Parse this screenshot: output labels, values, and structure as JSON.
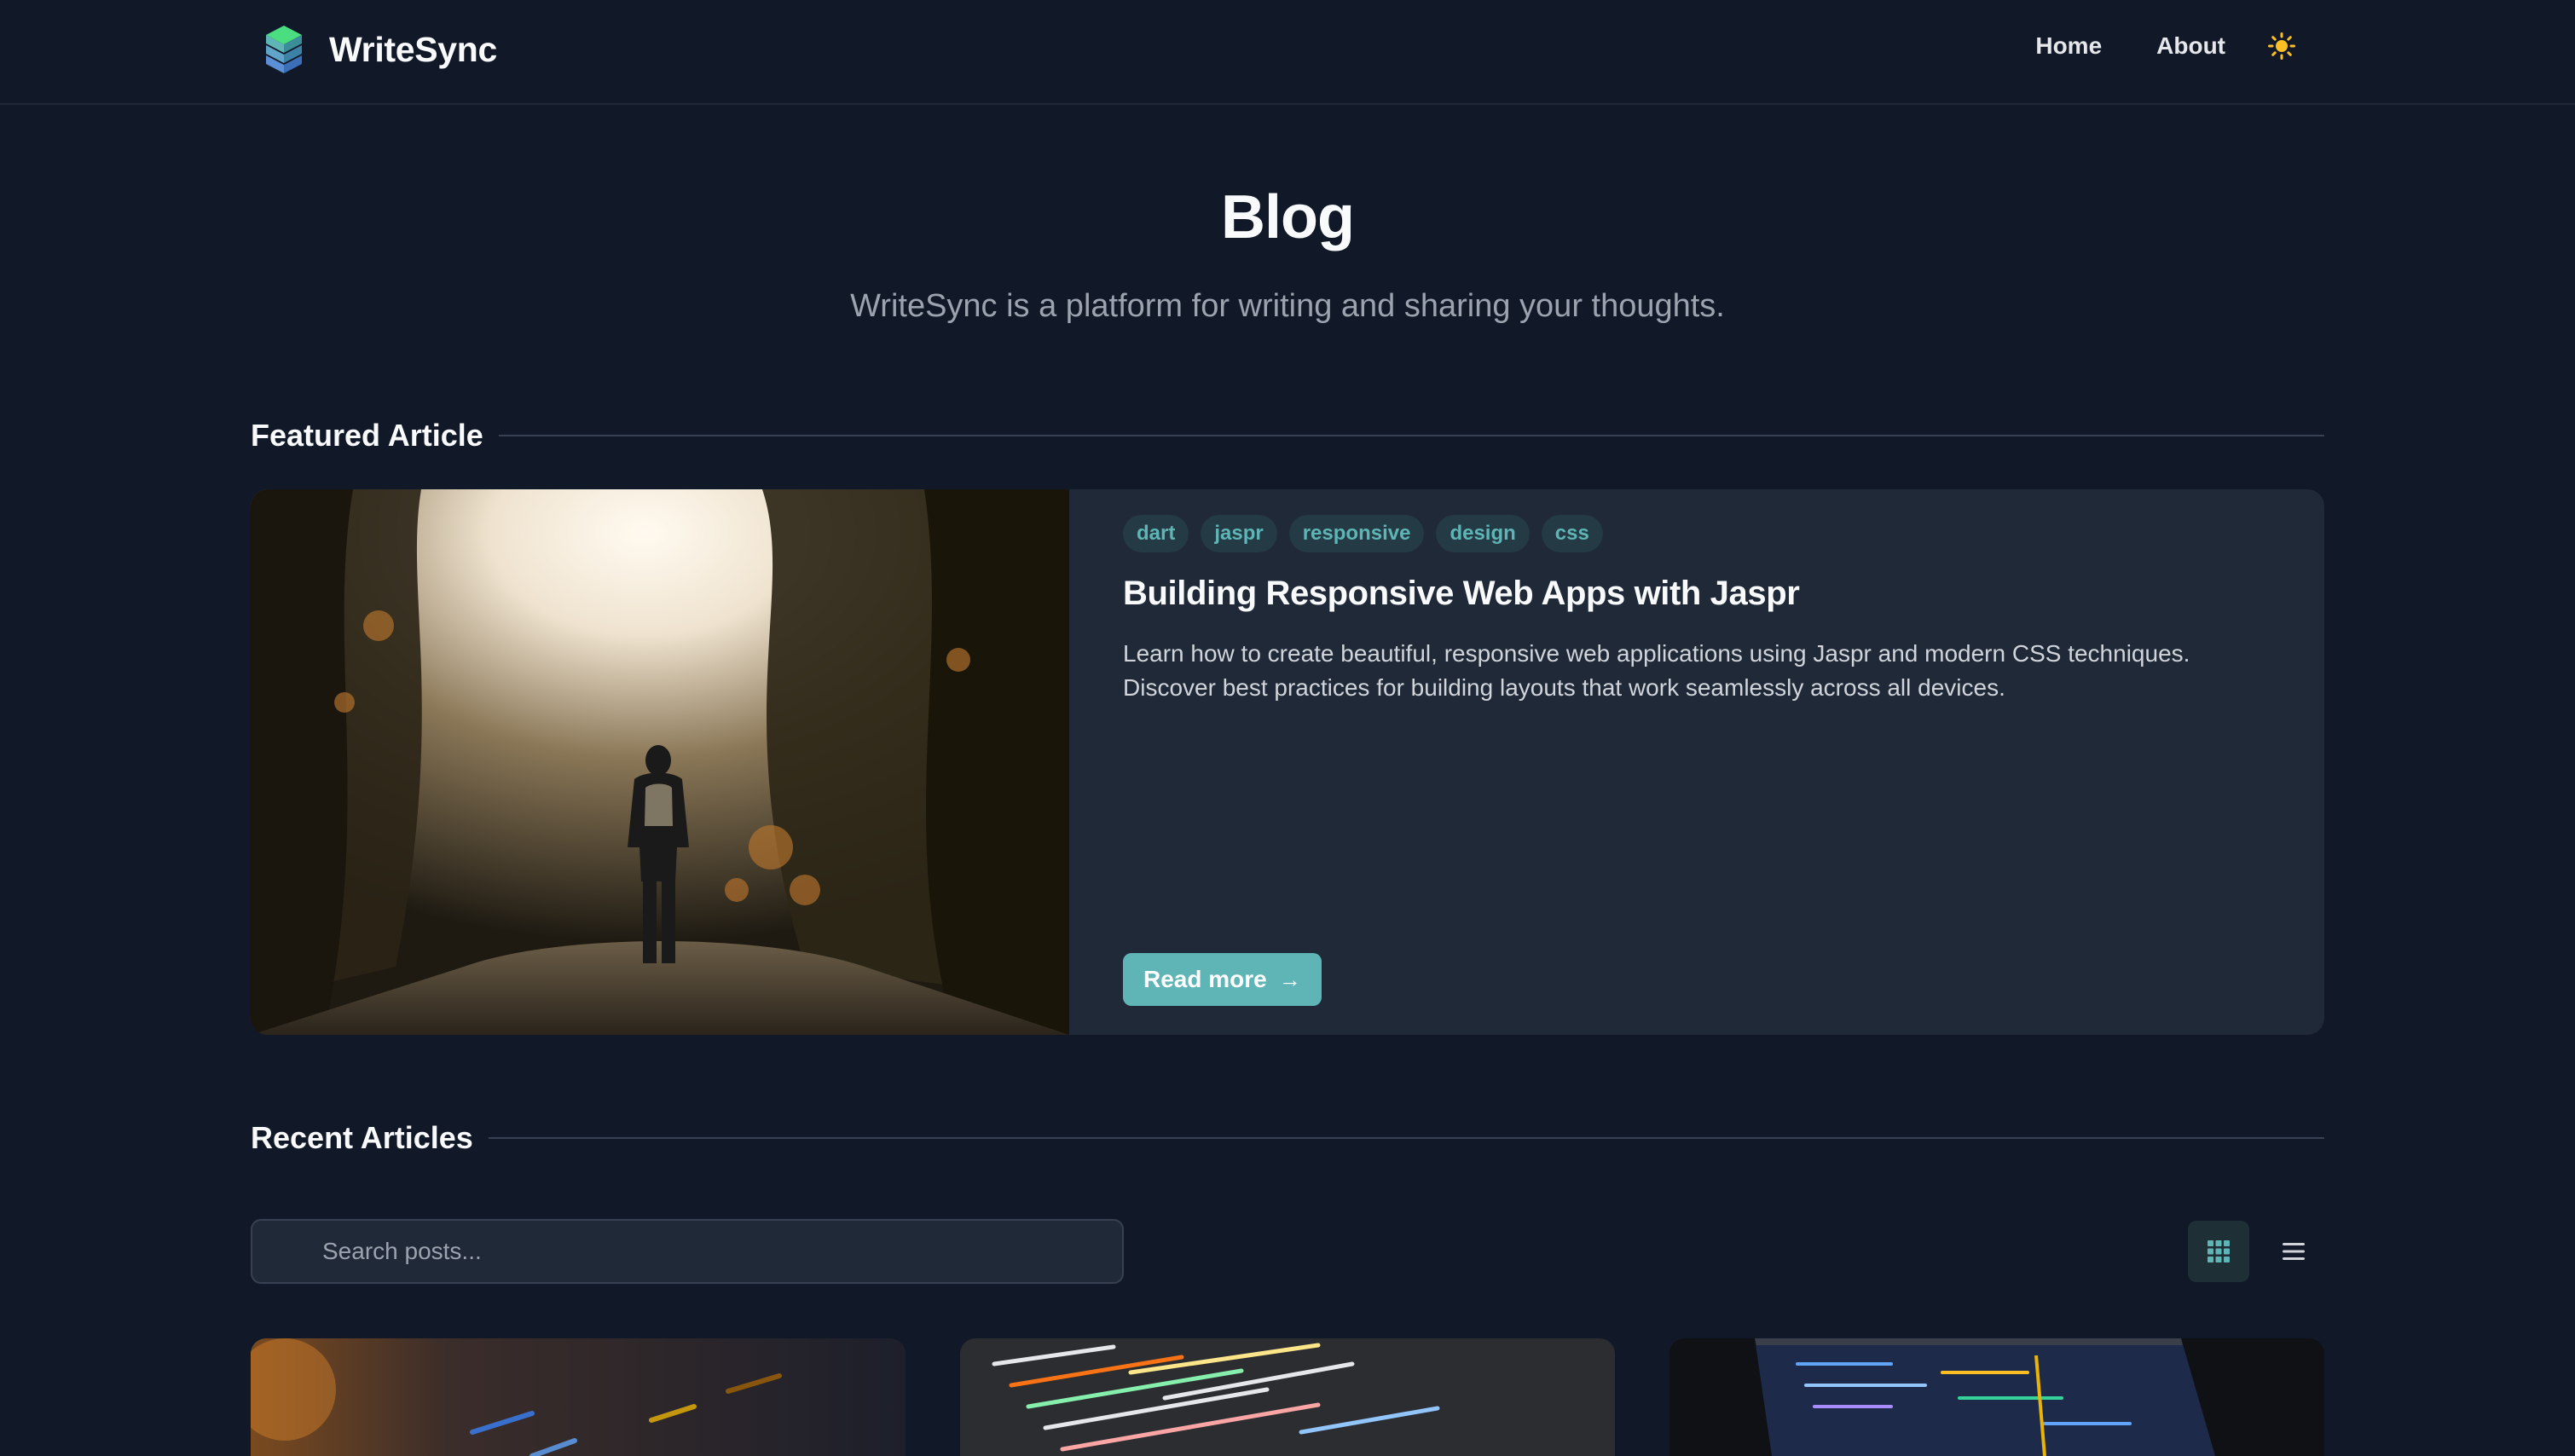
{
  "app": {
    "name": "WriteSync"
  },
  "nav": {
    "home": "Home",
    "about": "About",
    "theme_icon": "sun-icon"
  },
  "hero": {
    "title": "Blog",
    "subtitle": "WriteSync is a platform for writing and sharing your thoughts."
  },
  "featured": {
    "section_label": "Featured Article",
    "tags": [
      "dart",
      "jaspr",
      "responsive",
      "design",
      "css"
    ],
    "title": "Building Responsive Web Apps with Jaspr",
    "description": "Learn how to create beautiful, responsive web applications using Jaspr and modern CSS techniques. Discover best practices for building layouts that work seamlessly across all devices.",
    "cta": "Read more"
  },
  "recent": {
    "section_label": "Recent Articles",
    "search_placeholder": "Search posts...",
    "views": [
      "grid-view-icon",
      "list-view-icon"
    ],
    "active_view": "grid"
  },
  "colors": {
    "background": "#111827",
    "surface": "#1f2937",
    "accent": "#5fb5b6",
    "muted_text": "#9ca3af"
  }
}
